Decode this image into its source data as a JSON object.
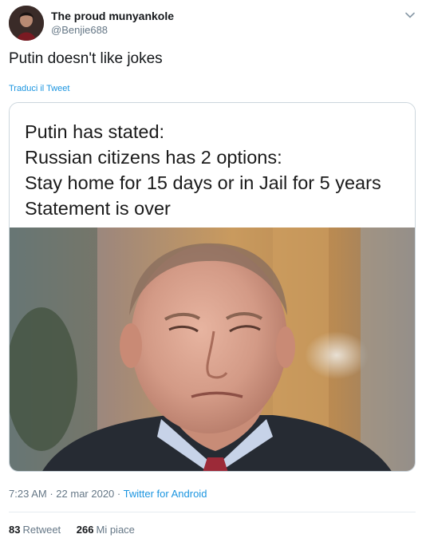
{
  "user": {
    "display_name": "The proud munyankole",
    "handle": "@Benjie688"
  },
  "tweet": {
    "text": "Putin doesn't like jokes",
    "translate_label": "Traduci il Tweet"
  },
  "media": {
    "caption_lines": [
      "Putin has stated:",
      "Russian citizens has 2 options:",
      "Stay home for 15 days or in Jail for 5 years",
      "Statement is over"
    ]
  },
  "meta": {
    "time": "7:23 AM",
    "separator": "·",
    "date": "22 mar 2020",
    "source": "Twitter for Android"
  },
  "stats": {
    "retweets_count": "83",
    "retweets_label": "Retweet",
    "likes_count": "266",
    "likes_label": "Mi piace"
  },
  "colors": {
    "link": "#1b95e0",
    "secondary_text": "#657786",
    "divider": "#e6ecf0"
  },
  "icons": {
    "caret": "chevron-down-icon"
  }
}
